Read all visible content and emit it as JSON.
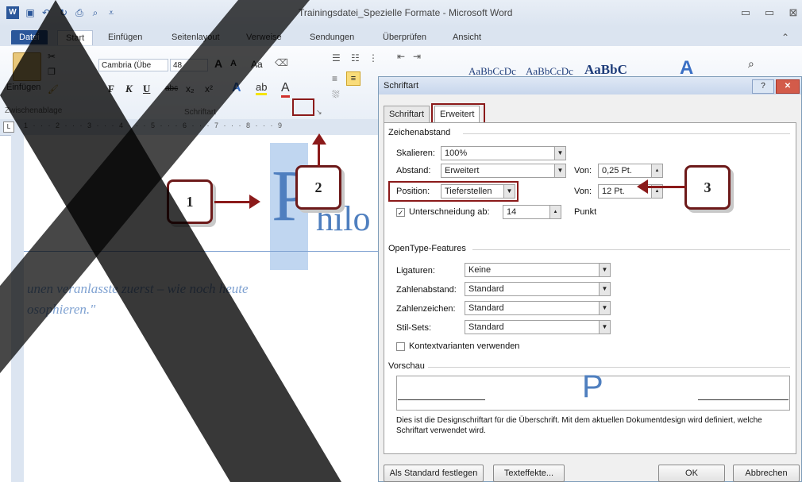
{
  "window": {
    "title": "Trainingsdatei_Spezielle Formate - Microsoft Word",
    "minimize": "▭",
    "restore": "▭",
    "close": "⊠"
  },
  "ribbon_tabs": [
    "Datei",
    "Start",
    "Einfügen",
    "Seitenlayout",
    "Verweise",
    "Sendungen",
    "Überprüfen",
    "Ansicht"
  ],
  "ribbon": {
    "paste_label": "Einfügen",
    "clipboard_group": "Zwischenablage",
    "font_name": "Cambria (Übe",
    "font_size": "48",
    "font_group": "Schriftart",
    "bold": "F",
    "italic": "K",
    "underline": "U",
    "strike": "abc",
    "sub": "x₂",
    "sup": "x²",
    "styles": [
      "AaBbCcDc",
      "AaBbCcDc",
      "AaBbC"
    ],
    "grow": "A",
    "shrink": "A",
    "case": "Aa"
  },
  "ruler": {
    "marks": "1 · · · 2 · · · 3 · · · 4 · · · 5 · · · 6 · · · 7 · · · 8 · · · 9"
  },
  "document": {
    "heading_letter": "P",
    "heading_rest": "hilo",
    "quote_line1": "unen veranlasste zuerst – wie noch heute",
    "quote_line2": "osophieren.\""
  },
  "dialog": {
    "title": "Schriftart",
    "help": "?",
    "close": "✕",
    "tabs": [
      "Schriftart",
      "Erweitert"
    ],
    "section_spacing": "Zeichenabstand",
    "scale_label": "Skalieren:",
    "scale_value": "100%",
    "spacing_label": "Abstand:",
    "spacing_value": "Erweitert",
    "spacing_by_label": "Von:",
    "spacing_by_value": "0,25 Pt.",
    "position_label": "Position:",
    "position_value": "Tieferstellen",
    "position_by_label": "Von:",
    "position_by_value": "12 Pt.",
    "kerning_label": "Unterschneidung ab:",
    "kerning_value": "14",
    "kerning_unit": "Punkt",
    "section_opentype": "OpenType-Features",
    "ligatures_label": "Ligaturen:",
    "ligatures_value": "Keine",
    "numspacing_label": "Zahlenabstand:",
    "numspacing_value": "Standard",
    "numforms_label": "Zahlenzeichen:",
    "numforms_value": "Standard",
    "stylesets_label": "Stil-Sets:",
    "stylesets_value": "Standard",
    "contextual_label": "Kontextvarianten verwenden",
    "section_preview": "Vorschau",
    "preview_letter": "P",
    "description": "Dies ist die Designschriftart für die Überschrift. Mit dem aktuellen Dokumentdesign wird definiert, welche Schriftart verwendet wird.",
    "btn_default": "Als Standard festlegen",
    "btn_effects": "Texteffekte...",
    "btn_ok": "OK",
    "btn_cancel": "Abbrechen"
  },
  "callouts": [
    "1",
    "2",
    "3"
  ]
}
